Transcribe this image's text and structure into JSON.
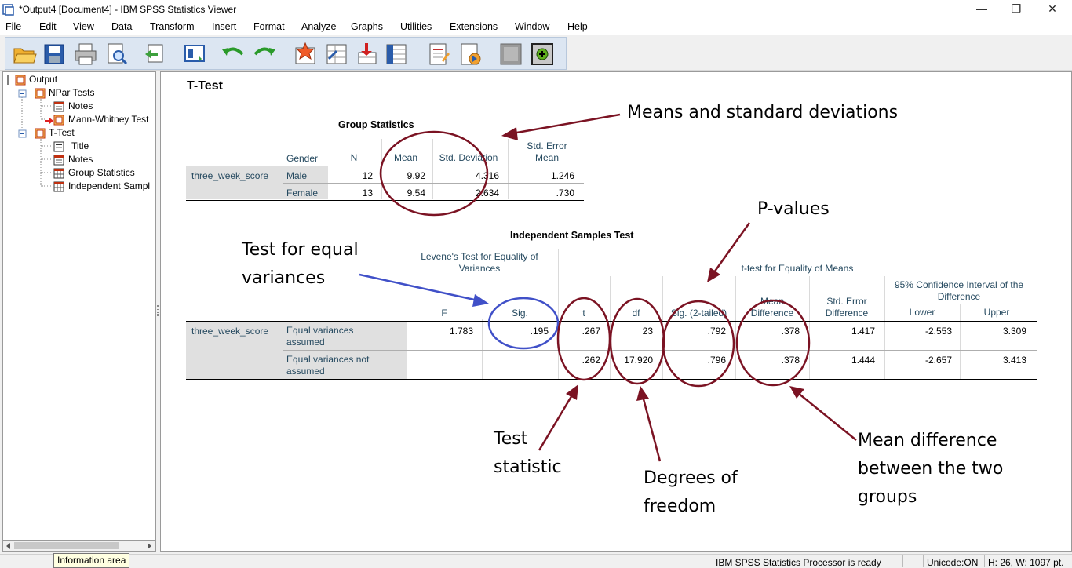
{
  "window": {
    "title": "*Output4 [Document4] - IBM SPSS Statistics Viewer",
    "minimize": "—",
    "restore": "❐",
    "close": "✕"
  },
  "menu": [
    "File",
    "Edit",
    "View",
    "Data",
    "Transform",
    "Insert",
    "Format",
    "Analyze",
    "Graphs",
    "Utilities",
    "Extensions",
    "Window",
    "Help"
  ],
  "toolbar_icons": [
    "open-icon",
    "save-icon",
    "print-icon",
    "print-preview-icon",
    "export-icon",
    "recall-dialog-icon",
    "undo-icon",
    "redo-icon",
    "goto-data-icon",
    "goto-case-icon",
    "goto-variable-icon",
    "variables-icon",
    "insert-heading-icon",
    "insert-title-icon",
    "designate-window-icon",
    "add-output-icon"
  ],
  "tree": {
    "root": "Output",
    "npar": "NPar Tests",
    "npar_notes": "Notes",
    "mann_whitney": "Mann-Whitney Test",
    "ttest": "T-Test",
    "title": "Title",
    "notes": "Notes",
    "group_stats": "Group Statistics",
    "indep": "Independent Sampl"
  },
  "output": {
    "heading": "T-Test",
    "group_stats": {
      "title": "Group Statistics",
      "headers": [
        "Gender",
        "N",
        "Mean",
        "Std. Deviation",
        "Std. Error",
        "Mean"
      ],
      "variable": "three_week_score",
      "rows": [
        {
          "group": "Male",
          "n": "12",
          "mean": "9.92",
          "sd": "4.316",
          "se": "1.246"
        },
        {
          "group": "Female",
          "n": "13",
          "mean": "9.54",
          "sd": "2.634",
          "se": ".730"
        }
      ]
    },
    "indep_test": {
      "title": "Independent Samples Test",
      "levene_header_1": "Levene's Test for Equality of",
      "levene_header_2": "Variances",
      "ttest_header": "t-test for Equality of Means",
      "ci_header_1": "95% Confidence Interval of the",
      "ci_header_2": "Difference",
      "col_f": "F",
      "col_sig": "Sig.",
      "col_t": "t",
      "col_df": "df",
      "col_sig2": "Sig. (2-tailed)",
      "col_md_1": "Mean",
      "col_md_2": "Difference",
      "col_sed_1": "Std. Error",
      "col_sed_2": "Difference",
      "col_lower": "Lower",
      "col_upper": "Upper",
      "variable": "three_week_score",
      "rows": [
        {
          "label_1": "Equal variances",
          "label_2": "assumed",
          "f": "1.783",
          "sig": ".195",
          "t": ".267",
          "df": "23",
          "sig2": ".792",
          "md": ".378",
          "sed": "1.417",
          "lower": "-2.553",
          "upper": "3.309"
        },
        {
          "label_1": "Equal variances not",
          "label_2": "assumed",
          "f": "",
          "sig": "",
          "t": ".262",
          "df": "17.920",
          "sig2": ".796",
          "md": ".378",
          "sed": "1.444",
          "lower": "-2.657",
          "upper": "3.413"
        }
      ]
    }
  },
  "annotations": {
    "means_sd": "Means and standard deviations",
    "pvalues": "P-values",
    "equal_var_1": "Test for equal",
    "equal_var_2": "variances",
    "test_stat_1": "Test",
    "test_stat_2": "statistic",
    "dof_1": "Degrees of",
    "dof_2": "freedom",
    "md_1": "Mean difference",
    "md_2": "between the two",
    "md_3": "groups"
  },
  "colors": {
    "annotation_dark_red": "#7b1323",
    "annotation_blue": "#4050c8",
    "header_text": "#264a60"
  },
  "status": {
    "info_area": "Information area",
    "processor": "IBM SPSS Statistics Processor is ready",
    "unicode": "Unicode:ON",
    "size": "H: 26, W: 1097 pt."
  }
}
